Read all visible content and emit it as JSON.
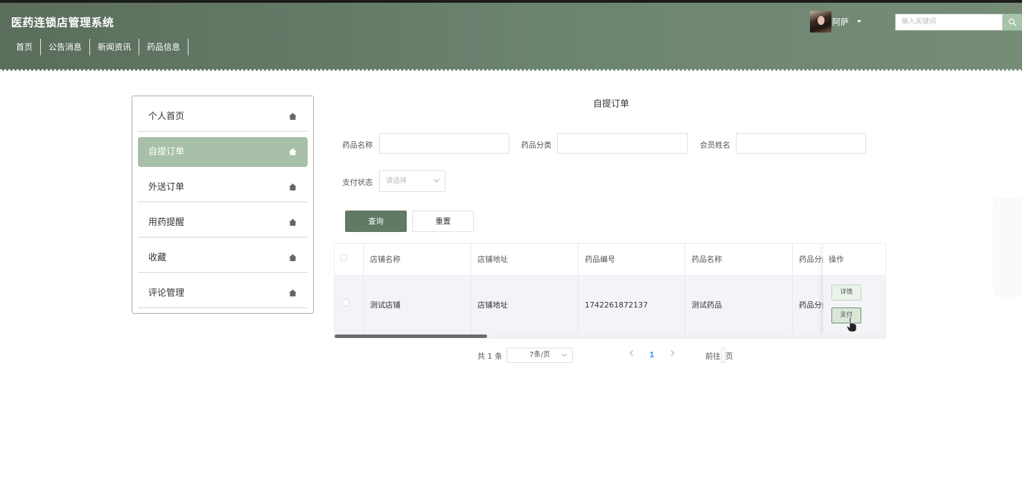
{
  "header": {
    "site_title": "医药连锁店管理系统",
    "nav": [
      "首页",
      "公告消息",
      "新闻资讯",
      "药品信息"
    ],
    "user_name": "阿萨",
    "search_placeholder": "输入关键词"
  },
  "sidebar": {
    "items": [
      {
        "label": "个人首页",
        "active": false
      },
      {
        "label": "自提订单",
        "active": true
      },
      {
        "label": "外送订单",
        "active": false
      },
      {
        "label": "用药提醒",
        "active": false
      },
      {
        "label": "收藏",
        "active": false
      },
      {
        "label": "评论管理",
        "active": false
      }
    ]
  },
  "main": {
    "title": "自提订单",
    "filters": {
      "drug_name_label": "药品名称",
      "drug_category_label": "药品分类",
      "member_name_label": "会员姓名",
      "pay_status_label": "支付状态",
      "pay_status_placeholder": "请选择"
    },
    "buttons": {
      "query": "查询",
      "reset": "重置"
    },
    "table": {
      "headers": [
        "店铺名称",
        "店铺地址",
        "药品编号",
        "药品名称",
        "药品分类",
        "操作"
      ],
      "rows": [
        {
          "shop_name": "测试店铺",
          "shop_address": "店铺地址",
          "drug_code": "1742261872137",
          "drug_name": "测试药品",
          "drug_category": "药品分类"
        }
      ],
      "actions": {
        "detail": "详情",
        "pay": "支付"
      }
    },
    "pagination": {
      "total": "共 1 条",
      "page_size": "7条/页",
      "current_page": "1",
      "goto_label": "前往",
      "page_unit": "页"
    }
  },
  "colors": {
    "header_bg": "#6b8470",
    "active_side": "#a8bfa9",
    "primary_btn": "#607a65",
    "pager_active": "#409eff"
  }
}
